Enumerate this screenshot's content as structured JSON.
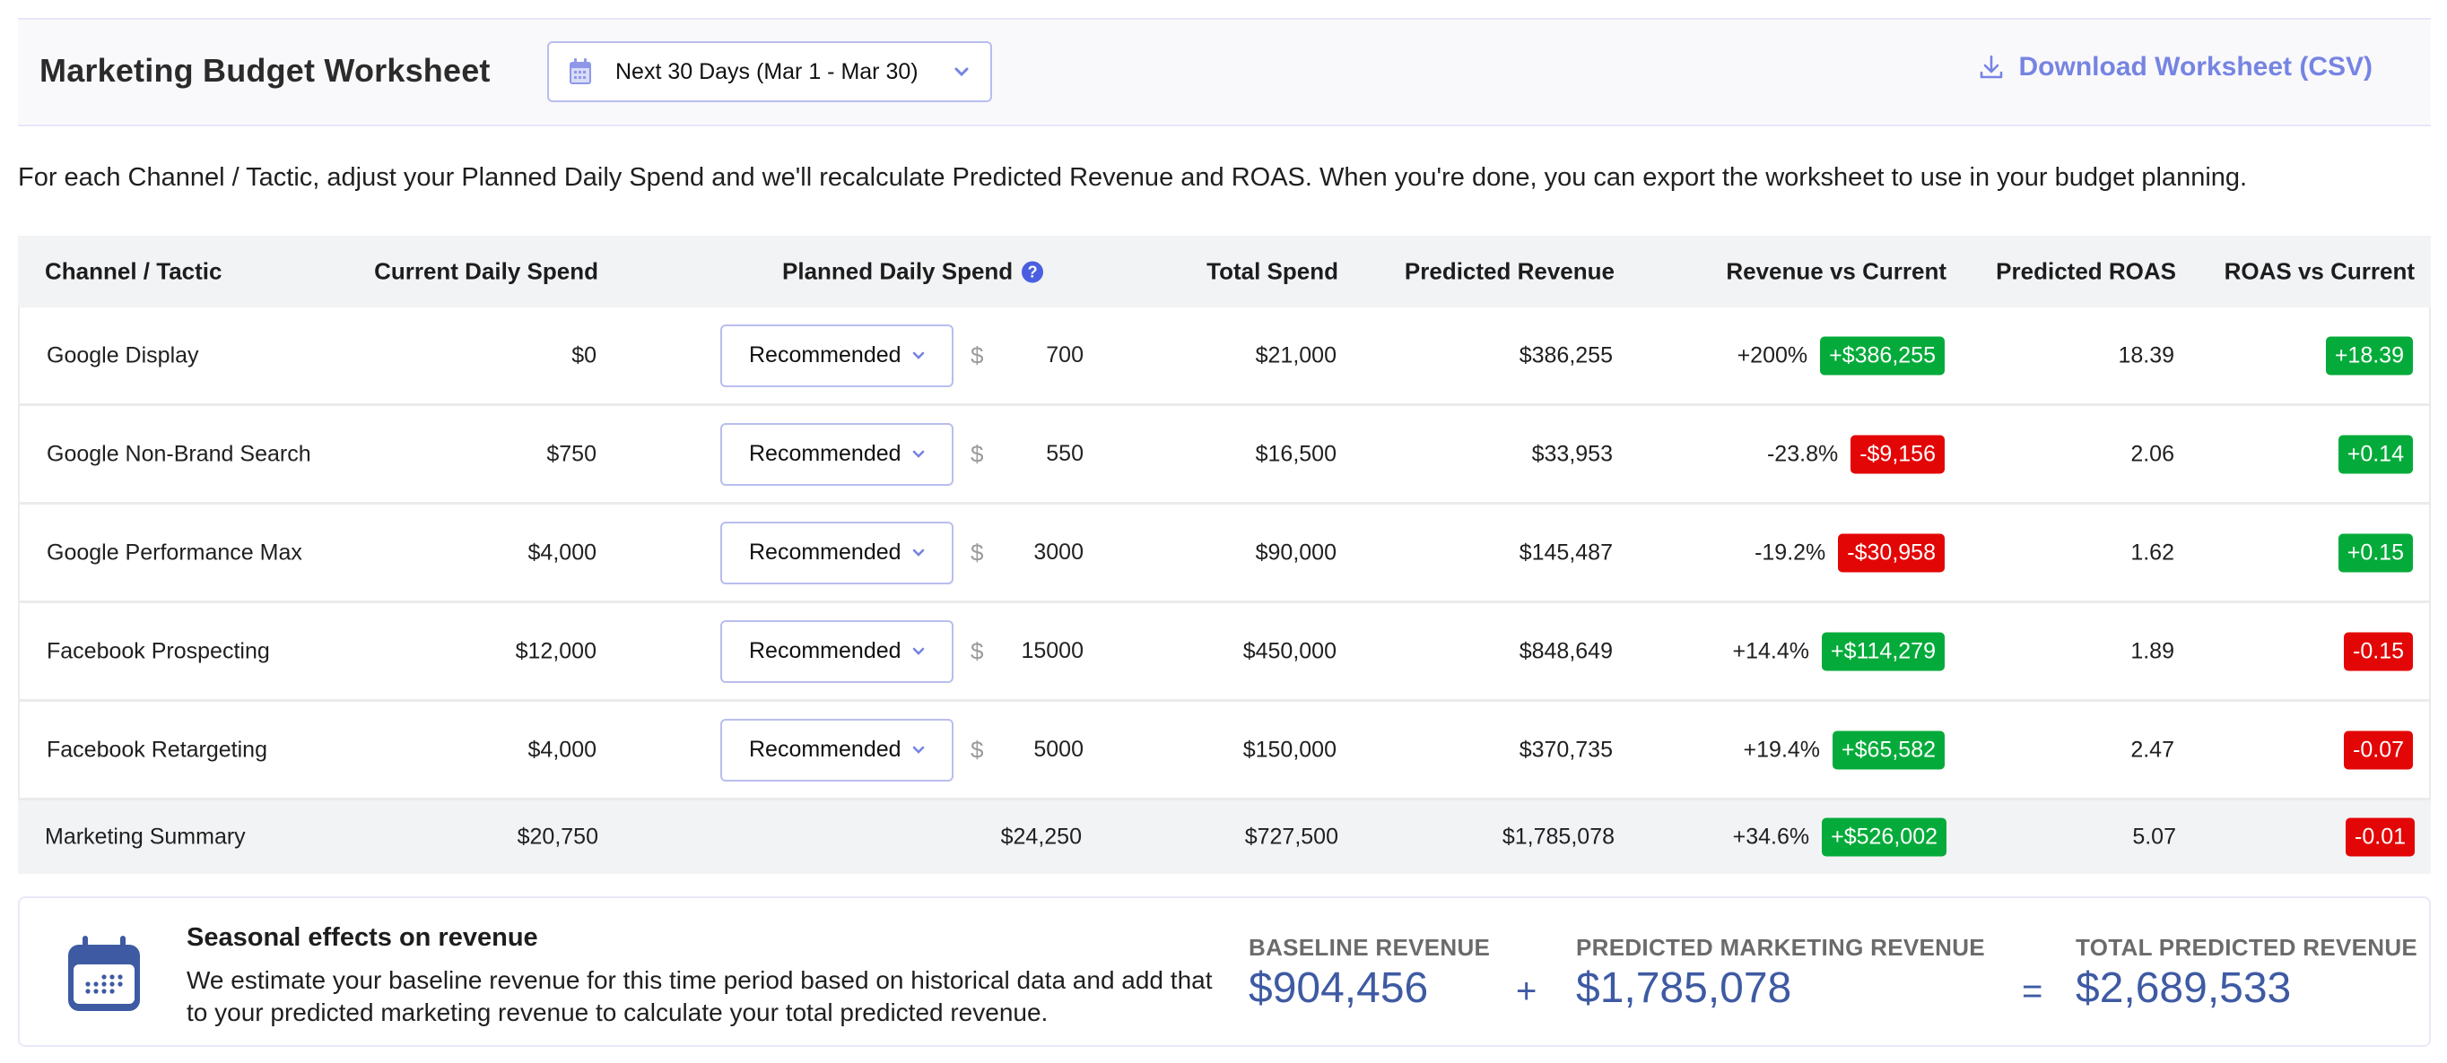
{
  "header": {
    "title": "Marketing Budget Worksheet",
    "date_range": {
      "selected": "Next 30 Days (Mar 1 - Mar 30)",
      "icon": "calendar-icon"
    },
    "download_label": "Download Worksheet (CSV)",
    "download_icon": "download-icon"
  },
  "description": "For each Channel / Tactic, adjust your Planned Daily Spend and we'll recalculate Predicted Revenue and ROAS. When you're done, you can export the worksheet to use in your budget planning.",
  "table": {
    "columns": {
      "channel": "Channel / Tactic",
      "current": "Current Daily Spend",
      "planned": "Planned Daily Spend",
      "planned_help": "?",
      "total": "Total Spend",
      "revenue": "Predicted Revenue",
      "rev_vs": "Revenue vs Current",
      "roas": "Predicted ROAS",
      "roas_vs": "ROAS vs Current"
    },
    "currency_symbol": "$",
    "rows": [
      {
        "channel": "Google Display",
        "current": "$0",
        "mode": "Recommended",
        "planned": "700",
        "total": "$21,000",
        "revenue": "$386,255",
        "rev_pct": "+200%",
        "rev_delta": "+$386,255",
        "rev_delta_sign": "pos",
        "roas": "18.39",
        "roas_delta": "+18.39",
        "roas_delta_sign": "pos"
      },
      {
        "channel": "Google Non-Brand Search",
        "current": "$750",
        "mode": "Recommended",
        "planned": "550",
        "total": "$16,500",
        "revenue": "$33,953",
        "rev_pct": "-23.8%",
        "rev_delta": "-$9,156",
        "rev_delta_sign": "neg",
        "roas": "2.06",
        "roas_delta": "+0.14",
        "roas_delta_sign": "pos"
      },
      {
        "channel": "Google Performance Max",
        "current": "$4,000",
        "mode": "Recommended",
        "planned": "3000",
        "total": "$90,000",
        "revenue": "$145,487",
        "rev_pct": "-19.2%",
        "rev_delta": "-$30,958",
        "rev_delta_sign": "neg",
        "roas": "1.62",
        "roas_delta": "+0.15",
        "roas_delta_sign": "pos"
      },
      {
        "channel": "Facebook Prospecting",
        "current": "$12,000",
        "mode": "Recommended",
        "planned": "15000",
        "total": "$450,000",
        "revenue": "$848,649",
        "rev_pct": "+14.4%",
        "rev_delta": "+$114,279",
        "rev_delta_sign": "pos",
        "roas": "1.89",
        "roas_delta": "-0.15",
        "roas_delta_sign": "neg"
      },
      {
        "channel": "Facebook Retargeting",
        "current": "$4,000",
        "mode": "Recommended",
        "planned": "5000",
        "total": "$150,000",
        "revenue": "$370,735",
        "rev_pct": "+19.4%",
        "rev_delta": "+$65,582",
        "rev_delta_sign": "pos",
        "roas": "2.47",
        "roas_delta": "-0.07",
        "roas_delta_sign": "neg"
      }
    ],
    "summary": {
      "channel": "Marketing Summary",
      "current": "$20,750",
      "planned": "$24,250",
      "total": "$727,500",
      "revenue": "$1,785,078",
      "rev_pct": "+34.6%",
      "rev_delta": "+$526,002",
      "rev_delta_sign": "pos",
      "roas": "5.07",
      "roas_delta": "-0.01",
      "roas_delta_sign": "neg"
    }
  },
  "seasonal": {
    "icon": "calendar-icon",
    "title": "Seasonal effects on revenue",
    "description": "We estimate your baseline revenue for this time period based on historical data and add that to your predicted marketing revenue to calculate your total predicted revenue.",
    "baseline_label": "BASELINE REVENUE",
    "baseline_value": "$904,456",
    "plus": "+",
    "predicted_label": "PREDICTED MARKETING REVENUE",
    "predicted_value": "$1,785,078",
    "equals": "=",
    "total_label": "TOTAL PREDICTED REVENUE",
    "total_value": "$2,689,533"
  },
  "colors": {
    "accent": "#7684e2",
    "positive": "#05ab3a",
    "negative": "#e30606",
    "metric_value": "#3e5aa3",
    "help_icon": "#4a5fe0"
  }
}
